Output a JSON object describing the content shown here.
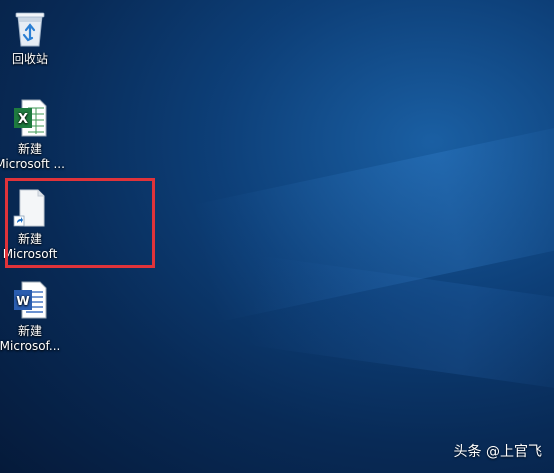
{
  "desktop": {
    "icons": [
      {
        "label": "回收站",
        "icon": "recycle-bin-icon"
      },
      {
        "label": "新建\nMicrosoft ...",
        "line1": "新建",
        "line2": "Microsoft ...",
        "icon": "excel-file-icon"
      },
      {
        "label": "新建\nMicrosoft",
        "line1": "新建",
        "line2": "Microsoft",
        "icon": "blank-file-shortcut-icon"
      },
      {
        "label": "新建\nMicrosof...",
        "line1": "新建",
        "line2": "Microsof...",
        "icon": "word-file-icon"
      }
    ],
    "highlight_color": "#e0333a"
  },
  "watermark": {
    "text": "头条 @上官飞"
  }
}
